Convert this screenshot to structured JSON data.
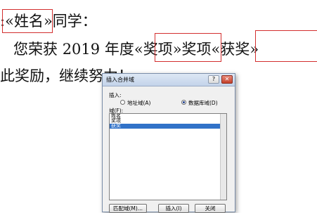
{
  "document": {
    "line1_prefix": ":",
    "field_name": "姓名",
    "line1_suffix": "同学：",
    "line2_start": "您荣获",
    "line2_year": "2019",
    "line2_mid": "年度",
    "field_award_item": "奖项",
    "line2_word": "奖项",
    "field_award_type": "获奖",
    "line3": "此奖励，继续努力！"
  },
  "colors": {
    "field_highlight": "#d32f2f",
    "selection": "#3172c8"
  },
  "dialog": {
    "title": "插入合并域",
    "help_label": "?",
    "close_label": "✕",
    "insert_group_label": "插入:",
    "radio_address": "地址域(A)",
    "radio_database": "数据库域(D)",
    "selected_radio": "数据库域(D)",
    "fields_label": "域(F):",
    "fields": [
      {
        "label": "姓名",
        "selected": false
      },
      {
        "label": "奖项",
        "selected": false
      },
      {
        "label": "获奖",
        "selected": true
      }
    ],
    "match_button": "匹配域(M)...",
    "insert_button": "插入(I)",
    "close_button": "关闭"
  }
}
